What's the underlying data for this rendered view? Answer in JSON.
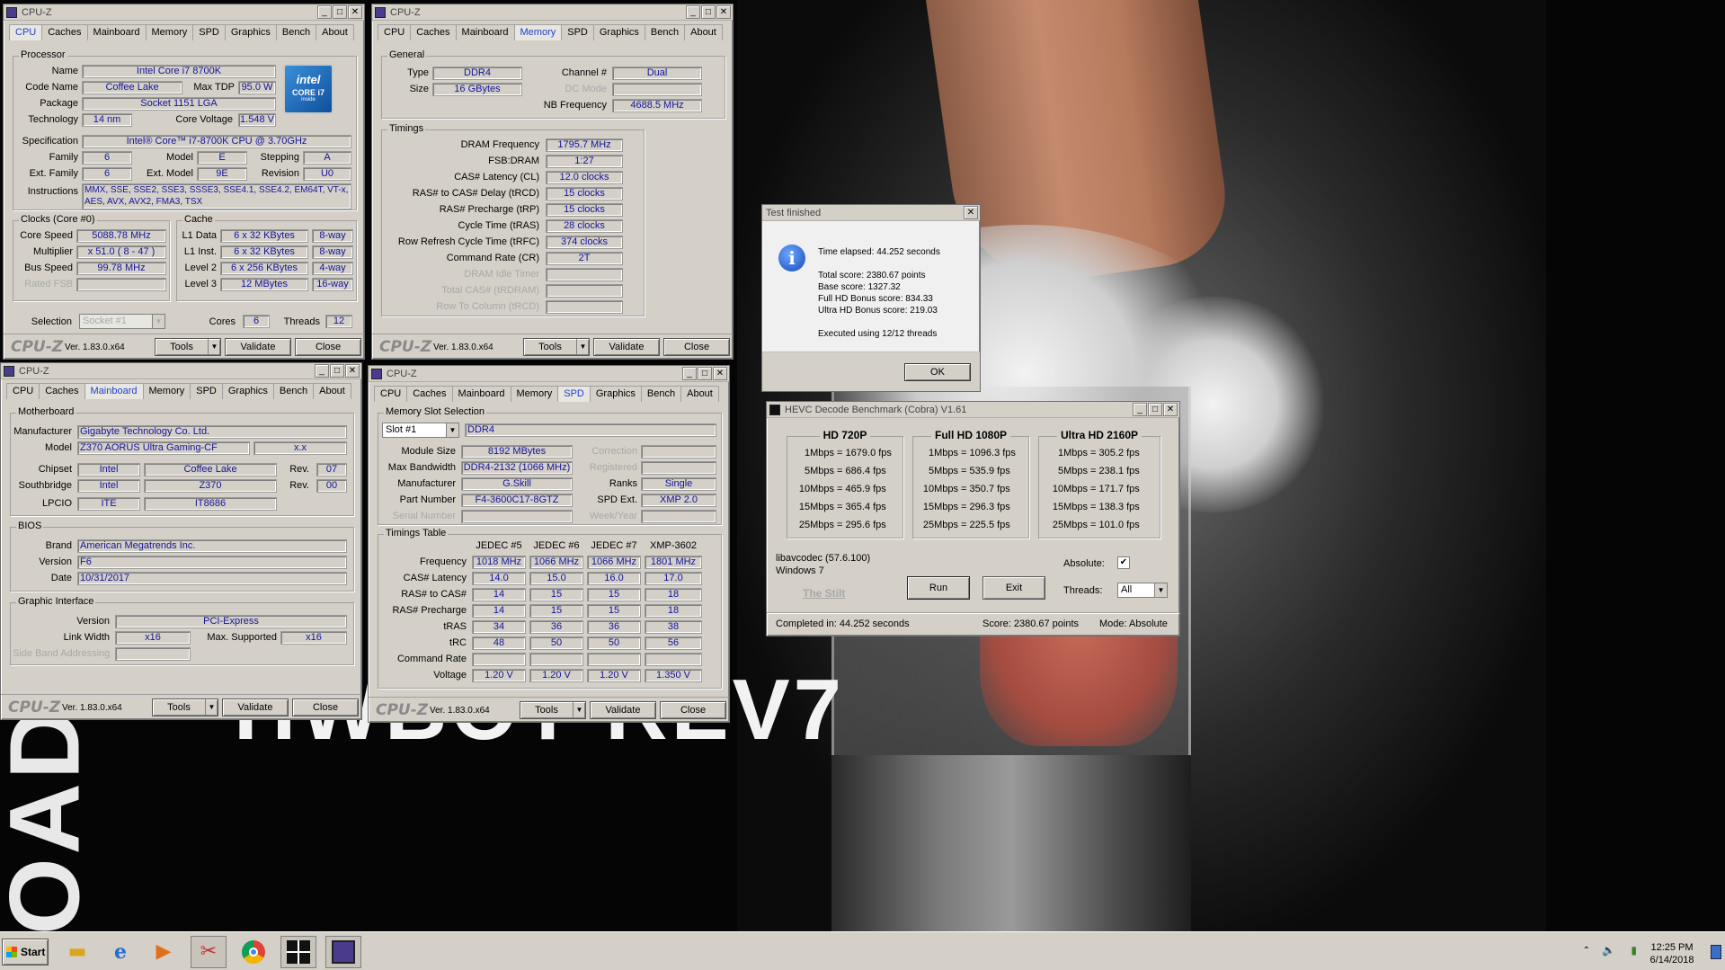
{
  "desktop": {
    "bg_text_1": "HWBOT REV7",
    "bg_text_2": "ROAD"
  },
  "cpuz_cpu": {
    "title": "CPU-Z",
    "tabs": [
      "CPU",
      "Caches",
      "Mainboard",
      "Memory",
      "SPD",
      "Graphics",
      "Bench",
      "About"
    ],
    "processor_group": "Processor",
    "name_label": "Name",
    "name": "Intel Core i7 8700K",
    "codename_label": "Code Name",
    "codename": "Coffee Lake",
    "maxtdp_label": "Max TDP",
    "maxtdp": "95.0 W",
    "package_label": "Package",
    "package": "Socket 1151 LGA",
    "tech_label": "Technology",
    "tech": "14 nm",
    "cv_label": "Core Voltage",
    "cv": "1.548 V",
    "spec_label": "Specification",
    "spec": "Intel® Core™ i7-8700K CPU @ 3.70GHz",
    "family_label": "Family",
    "family": "6",
    "model_label": "Model",
    "model": "E",
    "stepping_label": "Stepping",
    "stepping": "A",
    "extfamily_label": "Ext. Family",
    "extfamily": "6",
    "extmodel_label": "Ext. Model",
    "extmodel": "9E",
    "revision_label": "Revision",
    "revision": "U0",
    "instr_label": "Instructions",
    "instr": "MMX, SSE, SSE2, SSE3, SSSE3, SSE4.1, SSE4.2, EM64T, VT-x, AES, AVX, AVX2, FMA3, TSX",
    "logo": {
      "brand": "intel",
      "line": "CORE i7",
      "sub": "inside"
    },
    "clocks_group": "Clocks (Core #0)",
    "corespeed_label": "Core Speed",
    "corespeed": "5088.78 MHz",
    "mult_label": "Multiplier",
    "mult": "x 51.0 ( 8 - 47 )",
    "bus_label": "Bus Speed",
    "bus": "99.78 MHz",
    "fsb_label": "Rated FSB",
    "cache_group": "Cache",
    "l1d_label": "L1 Data",
    "l1d": "6 x 32 KBytes",
    "l1d_way": "8-way",
    "l1i_label": "L1 Inst.",
    "l1i": "6 x 32 KBytes",
    "l1i_way": "8-way",
    "l2_label": "Level 2",
    "l2": "6 x 256 KBytes",
    "l2_way": "4-way",
    "l3_label": "Level 3",
    "l3": "12 MBytes",
    "l3_way": "16-way",
    "selection_label": "Selection",
    "selection": "Socket #1",
    "cores_label": "Cores",
    "cores": "6",
    "threads_label": "Threads",
    "threads": "12",
    "brand": "CPU-Z",
    "version": "Ver. 1.83.0.x64",
    "tools": "Tools",
    "validate": "Validate",
    "close": "Close"
  },
  "cpuz_mem": {
    "title": "CPU-Z",
    "tabs": [
      "CPU",
      "Caches",
      "Mainboard",
      "Memory",
      "SPD",
      "Graphics",
      "Bench",
      "About"
    ],
    "general_group": "General",
    "type_label": "Type",
    "type": "DDR4",
    "size_label": "Size",
    "size": "16 GBytes",
    "channel_label": "Channel #",
    "channel": "Dual",
    "dcmode_label": "DC Mode",
    "nbfreq_label": "NB Frequency",
    "nbfreq": "4688.5 MHz",
    "timings_group": "Timings",
    "rows": [
      {
        "label": "DRAM Frequency",
        "value": "1795.7 MHz",
        "dis": false
      },
      {
        "label": "FSB:DRAM",
        "value": "1:27",
        "dis": false
      },
      {
        "label": "CAS# Latency (CL)",
        "value": "12.0 clocks",
        "dis": false
      },
      {
        "label": "RAS# to CAS# Delay (tRCD)",
        "value": "15 clocks",
        "dis": false
      },
      {
        "label": "RAS# Precharge (tRP)",
        "value": "15 clocks",
        "dis": false
      },
      {
        "label": "Cycle Time (tRAS)",
        "value": "28 clocks",
        "dis": false
      },
      {
        "label": "Row Refresh Cycle Time (tRFC)",
        "value": "374 clocks",
        "dis": false
      },
      {
        "label": "Command Rate (CR)",
        "value": "2T",
        "dis": false
      },
      {
        "label": "DRAM Idle Timer",
        "value": "",
        "dis": true
      },
      {
        "label": "Total CAS# (tRDRAM)",
        "value": "",
        "dis": true
      },
      {
        "label": "Row To Column (tRCD)",
        "value": "",
        "dis": true
      }
    ],
    "brand": "CPU-Z",
    "version": "Ver. 1.83.0.x64",
    "tools": "Tools",
    "validate": "Validate",
    "close": "Close"
  },
  "cpuz_mb": {
    "title": "CPU-Z",
    "tabs": [
      "CPU",
      "Caches",
      "Mainboard",
      "Memory",
      "SPD",
      "Graphics",
      "Bench",
      "About"
    ],
    "mb_group": "Motherboard",
    "manu_label": "Manufacturer",
    "manu": "Gigabyte Technology Co. Ltd.",
    "model_label": "Model",
    "model": "Z370 AORUS Ultra Gaming-CF",
    "model_rev": "x.x",
    "chipset_label": "Chipset",
    "chipset_v": "Intel",
    "chipset_n": "Coffee Lake",
    "chipset_rev_label": "Rev.",
    "chipset_rev": "07",
    "sb_label": "Southbridge",
    "sb_v": "Intel",
    "sb_n": "Z370",
    "sb_rev_label": "Rev.",
    "sb_rev": "00",
    "lpcio_label": "LPCIO",
    "lpcio_v": "ITE",
    "lpcio_n": "IT8686",
    "bios_group": "BIOS",
    "brand_label": "Brand",
    "bios_brand": "American Megatrends Inc.",
    "bver_label": "Version",
    "bver": "F6",
    "date_label": "Date",
    "date": "10/31/2017",
    "gi_group": "Graphic Interface",
    "giver_label": "Version",
    "giver": "PCI-Express",
    "lw_label": "Link Width",
    "lw": "x16",
    "ms_label": "Max. Supported",
    "ms": "x16",
    "sba_label": "Side Band Addressing",
    "brand": "CPU-Z",
    "version": "Ver. 1.83.0.x64",
    "tools": "Tools",
    "validate": "Validate",
    "close": "Close"
  },
  "cpuz_spd": {
    "title": "CPU-Z",
    "tabs": [
      "CPU",
      "Caches",
      "Mainboard",
      "Memory",
      "SPD",
      "Graphics",
      "Bench",
      "About"
    ],
    "slot_group": "Memory Slot Selection",
    "slot": "Slot #1",
    "slot_type": "DDR4",
    "modsize_label": "Module Size",
    "modsize": "8192 MBytes",
    "corr_label": "Correction",
    "maxbw_label": "Max Bandwidth",
    "maxbw": "DDR4-2132 (1066 MHz)",
    "reg_label": "Registered",
    "manu_label": "Manufacturer",
    "manu": "G.Skill",
    "ranks_label": "Ranks",
    "ranks": "Single",
    "pn_label": "Part Number",
    "pn": "F4-3600C17-8GTZ",
    "spdext_label": "SPD Ext.",
    "spdext": "XMP 2.0",
    "sn_label": "Serial Number",
    "wy_label": "Week/Year",
    "tt_group": "Timings Table",
    "cols": [
      "JEDEC #5",
      "JEDEC #6",
      "JEDEC #7",
      "XMP-3602"
    ],
    "rows": [
      {
        "label": "Frequency",
        "values": [
          "1018 MHz",
          "1066 MHz",
          "1066 MHz",
          "1801 MHz"
        ]
      },
      {
        "label": "CAS# Latency",
        "values": [
          "14.0",
          "15.0",
          "16.0",
          "17.0"
        ]
      },
      {
        "label": "RAS# to CAS#",
        "values": [
          "14",
          "15",
          "15",
          "18"
        ]
      },
      {
        "label": "RAS# Precharge",
        "values": [
          "14",
          "15",
          "15",
          "18"
        ]
      },
      {
        "label": "tRAS",
        "values": [
          "34",
          "36",
          "36",
          "38"
        ]
      },
      {
        "label": "tRC",
        "values": [
          "48",
          "50",
          "50",
          "56"
        ]
      },
      {
        "label": "Command Rate",
        "values": [
          "",
          "",
          "",
          ""
        ]
      },
      {
        "label": "Voltage",
        "values": [
          "1.20 V",
          "1.20 V",
          "1.20 V",
          "1.350 V"
        ]
      }
    ],
    "brand": "CPU-Z",
    "version": "Ver. 1.83.0.x64",
    "tools": "Tools",
    "validate": "Validate",
    "close": "Close"
  },
  "dialog": {
    "title": "Test finished",
    "lines": [
      "Time elapsed:  44.252 seconds",
      "",
      "Total score:  2380.67 points",
      "Base score: 1327.32",
      "Full HD Bonus score: 834.33",
      "Ultra HD Bonus score: 219.03",
      "",
      "Executed using 12/12 threads"
    ],
    "ok": "OK"
  },
  "hevc": {
    "title": "HEVC Decode Benchmark (Cobra) V1.61",
    "groups": [
      {
        "title": "HD 720P",
        "rows": [
          [
            "1Mbps",
            "1679.0 fps"
          ],
          [
            "5Mbps",
            "686.4 fps"
          ],
          [
            "10Mbps",
            "465.9 fps"
          ],
          [
            "15Mbps",
            "365.4 fps"
          ],
          [
            "25Mbps",
            "295.6 fps"
          ]
        ]
      },
      {
        "title": "Full HD 1080P",
        "rows": [
          [
            "1Mbps",
            "1096.3 fps"
          ],
          [
            "5Mbps",
            "535.9 fps"
          ],
          [
            "10Mbps",
            "350.7 fps"
          ],
          [
            "15Mbps",
            "296.3 fps"
          ],
          [
            "25Mbps",
            "225.5 fps"
          ]
        ]
      },
      {
        "title": "Ultra HD 2160P",
        "rows": [
          [
            "1Mbps",
            "305.2 fps"
          ],
          [
            "5Mbps",
            "238.1 fps"
          ],
          [
            "10Mbps",
            "171.7 fps"
          ],
          [
            "15Mbps",
            "138.3 fps"
          ],
          [
            "25Mbps",
            "101.0 fps"
          ]
        ]
      }
    ],
    "codec": "libavcodec (57.6.100)",
    "os": "Windows 7",
    "credit": "The Stilt",
    "run": "Run",
    "exit": "Exit",
    "absolute_label": "Absolute:",
    "absolute_mark": "✔",
    "threads_label": "Threads:",
    "threads": "All",
    "status_completed": "Completed in: 44.252 seconds",
    "status_score": "Score: 2380.67 points",
    "status_mode": "Mode: Absolute"
  },
  "taskbar": {
    "start": "Start",
    "time": "12:25 PM",
    "date": "6/14/2018"
  }
}
